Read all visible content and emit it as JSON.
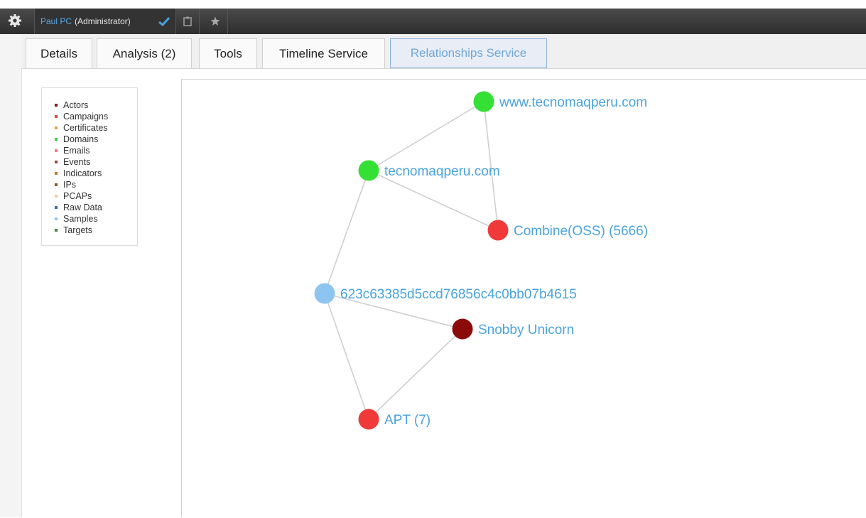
{
  "topbar": {
    "user_name": "Paul PC",
    "user_role": "(Administrator)",
    "icons": [
      "gear-icon",
      "check-icon",
      "clipboard-icon",
      "star-icon"
    ]
  },
  "tabs": [
    {
      "label": "Details"
    },
    {
      "label": "Analysis (2)"
    },
    {
      "label": "Tools"
    },
    {
      "label": "Timeline Service"
    },
    {
      "label": "Relationships Service",
      "active": true
    }
  ],
  "legend": {
    "items": [
      {
        "label": "Actors",
        "color": "#8b1a1a"
      },
      {
        "label": "Campaigns",
        "color": "#e8403a"
      },
      {
        "label": "Certificates",
        "color": "#f0a030"
      },
      {
        "label": "Domains",
        "color": "#3ad13a"
      },
      {
        "label": "Emails",
        "color": "#f08080"
      },
      {
        "label": "Events",
        "color": "#a04040"
      },
      {
        "label": "Indicators",
        "color": "#c07a30"
      },
      {
        "label": "IPs",
        "color": "#8b5a2b"
      },
      {
        "label": "PCAPs",
        "color": "#f5c890"
      },
      {
        "label": "Raw Data",
        "color": "#3a6ea5"
      },
      {
        "label": "Samples",
        "color": "#8ec5f0"
      },
      {
        "label": "Targets",
        "color": "#3a8a3a"
      }
    ]
  },
  "graph": {
    "nodes": [
      {
        "id": "www",
        "label": "www.tecnomaqperu.com",
        "type": "Domains",
        "color": "#33e033"
      },
      {
        "id": "tecno",
        "label": "tecnomaqperu.com",
        "type": "Domains",
        "color": "#33e033"
      },
      {
        "id": "combine",
        "label": "Combine(OSS) (5666)",
        "type": "Campaigns",
        "color": "#f03a3a"
      },
      {
        "id": "sample",
        "label": "623c63385d5ccd76856c4c0bb07b4615",
        "type": "Samples",
        "color": "#8ec5f0"
      },
      {
        "id": "snobby",
        "label": "Snobby Unicorn",
        "type": "Actors",
        "color": "#8b0a0a"
      },
      {
        "id": "apt",
        "label": "APT (7)",
        "type": "Campaigns",
        "color": "#f03a3a"
      }
    ],
    "edges": [
      [
        "www",
        "tecno"
      ],
      [
        "www",
        "combine"
      ],
      [
        "tecno",
        "combine"
      ],
      [
        "tecno",
        "sample"
      ],
      [
        "sample",
        "snobby"
      ],
      [
        "sample",
        "apt"
      ],
      [
        "snobby",
        "apt"
      ]
    ]
  }
}
